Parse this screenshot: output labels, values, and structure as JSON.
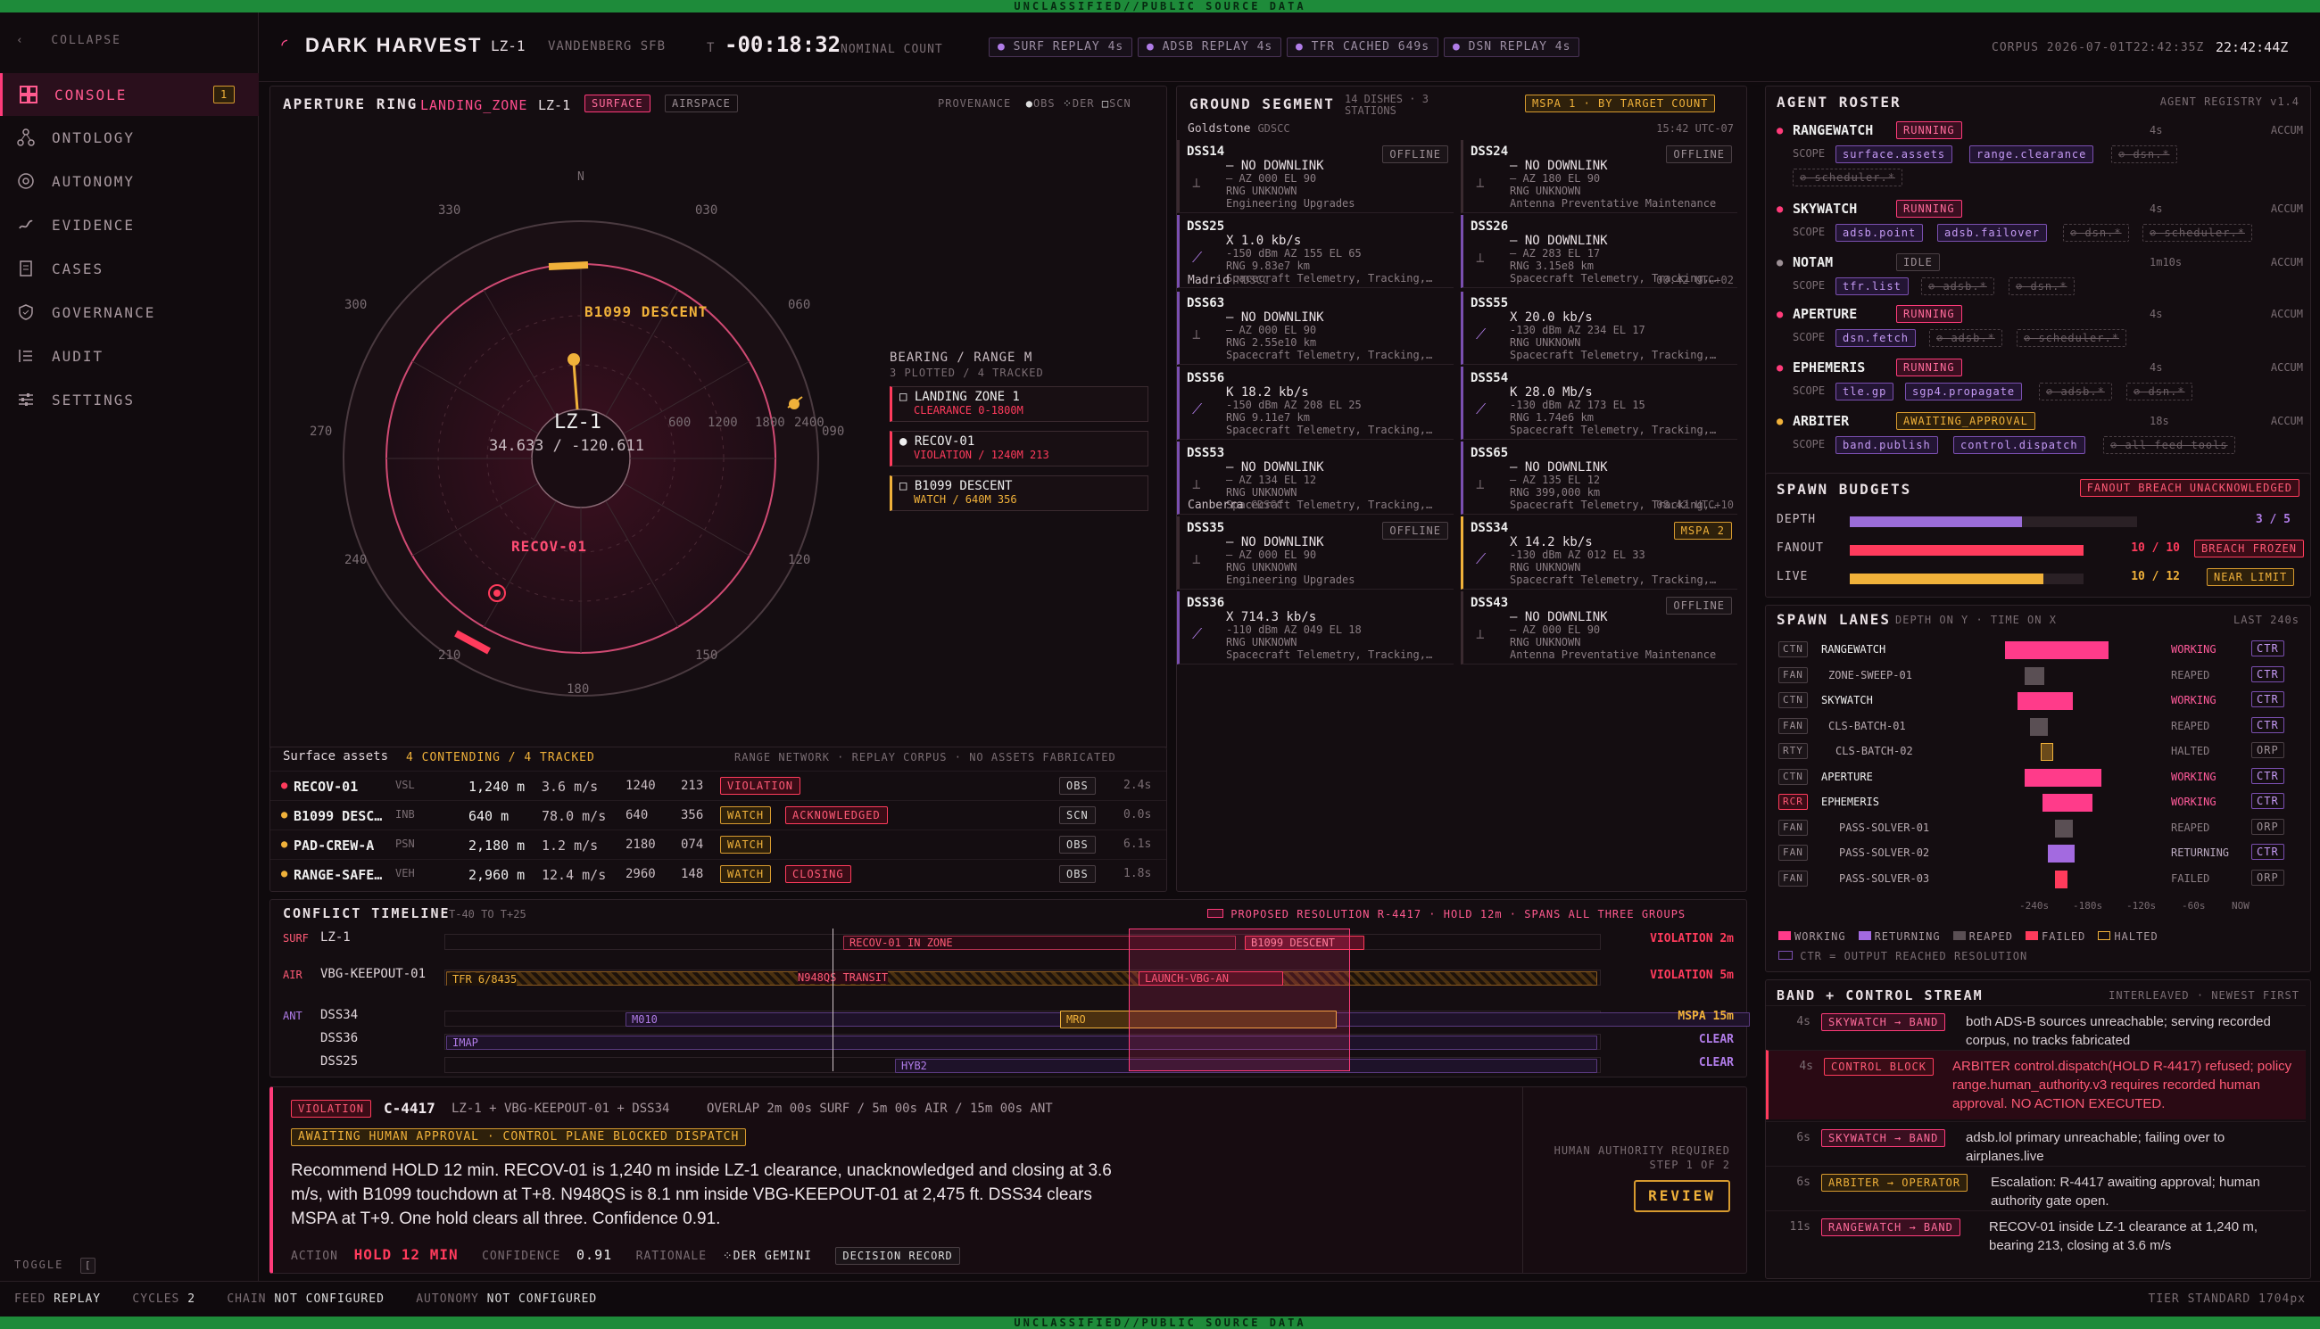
{
  "classification": "UNCLASSIFIED//PUBLIC SOURCE DATA",
  "sidebar": {
    "collapse": "COLLAPSE",
    "items": [
      {
        "label": "CONSOLE",
        "badge": "1"
      },
      {
        "label": "ONTOLOGY"
      },
      {
        "label": "AUTONOMY"
      },
      {
        "label": "EVIDENCE"
      },
      {
        "label": "CASES"
      },
      {
        "label": "GOVERNANCE"
      },
      {
        "label": "AUDIT"
      },
      {
        "label": "SETTINGS"
      }
    ],
    "toggle": "TOGGLE",
    "toggle_key": "["
  },
  "header": {
    "title": "DARK HARVEST",
    "zone": "LZ-1",
    "site": "VANDENBERG SFB",
    "t_label": "T",
    "countdown": "-00:18:32",
    "count_label": "NOMINAL COUNT",
    "chips": [
      "SURF REPLAY 4s",
      "ADSB REPLAY 4s",
      "TFR CACHED 649s",
      "DSN REPLAY 4s"
    ],
    "corpus": "CORPUS 2026-07-01T22:42:35Z",
    "clock": "22:42:44Z"
  },
  "aperture": {
    "title": "APERTURE RING",
    "zone_kind": "LANDING_ZONE",
    "zone": "LZ-1",
    "tab_surface": "SURFACE",
    "tab_airspace": "AIRSPACE",
    "prov_label": "PROVENANCE",
    "prov": [
      "OBS",
      "DER",
      "SCN"
    ],
    "center_label": "LZ-1",
    "center_coords": "34.633 / -120.611",
    "bearings": [
      "N",
      "030",
      "060",
      "090",
      "120",
      "150",
      "180",
      "210",
      "240",
      "270",
      "300",
      "330"
    ],
    "ranges": [
      "600",
      "1200",
      "1800",
      "2400"
    ],
    "target1": "B1099 DESCENT",
    "target2": "RECOV-01",
    "bearing_title": "BEARING / RANGE M",
    "bearing_sub": "3 PLOTTED / 4 TRACKED",
    "bearing_items": [
      {
        "name": "LANDING ZONE 1",
        "sub": "CLEARANCE 0-1800M"
      },
      {
        "name": "RECOV-01",
        "sub": "VIOLATION / 1240M 213"
      },
      {
        "name": "B1099 DESCENT",
        "sub": "WATCH / 640M 356"
      }
    ]
  },
  "assets": {
    "title": "Surface assets",
    "contending": "4 CONTENDING / 4 TRACKED",
    "note": "RANGE NETWORK · REPLAY CORPUS · NO ASSETS FABRICATED",
    "rows": [
      {
        "name": "RECOV-01",
        "type": "VSL",
        "range": "1,240 m",
        "speed": "3.6 m/s",
        "r": "1240",
        "b": "213",
        "tags": [
          "VIOLATION"
        ],
        "prov": "OBS",
        "age": "2.4s",
        "dot": "#ff3b5c"
      },
      {
        "name": "B1099 DESC…",
        "type": "INB",
        "range": "640 m",
        "speed": "78.0 m/s",
        "r": "640",
        "b": "356",
        "tags": [
          "WATCH",
          "ACKNOWLEDGED"
        ],
        "prov": "SCN",
        "age": "0.0s",
        "dot": "#f0b13a"
      },
      {
        "name": "PAD-CREW-A",
        "type": "PSN",
        "range": "2,180 m",
        "speed": "1.2 m/s",
        "r": "2180",
        "b": "074",
        "tags": [
          "WATCH"
        ],
        "prov": "OBS",
        "age": "6.1s",
        "dot": "#f0b13a"
      },
      {
        "name": "RANGE-SAFE…",
        "type": "VEH",
        "range": "2,960 m",
        "speed": "12.4 m/s",
        "r": "2960",
        "b": "148",
        "tags": [
          "WATCH",
          "CLOSING"
        ],
        "prov": "OBS",
        "age": "1.8s",
        "dot": "#f0b13a"
      }
    ]
  },
  "ground": {
    "title": "GROUND SEGMENT",
    "sub": "14 DISHES · 3 STATIONS",
    "mspa": "MSPA 1 · BY TARGET COUNT",
    "stations": [
      {
        "name": "Goldstone",
        "code": "GDSCC",
        "time": "15:42 UTC-07"
      },
      {
        "name": "Madrid",
        "code": "MDSCC",
        "time": "00:42 UTC+02"
      },
      {
        "name": "Canberra",
        "code": "CDSCC",
        "time": "08:42 UTC+10"
      }
    ],
    "dishes": [
      {
        "id": "DSS14",
        "badge": "OFFLINE",
        "l1": "— NO DOWNLINK",
        "l2": "— AZ 000 EL 90",
        "l3": "RNG UNKNOWN",
        "l4": "Engineering Upgrades"
      },
      {
        "id": "DSS24",
        "badge": "OFFLINE",
        "l1": "— NO DOWNLINK",
        "l2": "— AZ 180 EL 90",
        "l3": "RNG UNKNOWN",
        "l4": "Antenna Preventative Maintenance"
      },
      {
        "id": "DSS25",
        "badge": "",
        "l1": "X 1.0 kb/s",
        "l2": "-150 dBm AZ 155 EL 65",
        "l3": "RNG 9.83e7 km",
        "l4": "Spacecraft Telemetry, Tracking,…"
      },
      {
        "id": "DSS26",
        "badge": "",
        "l1": "— NO DOWNLINK",
        "l2": "— AZ 283 EL 17",
        "l3": "RNG 3.15e8 km",
        "l4": "Spacecraft Telemetry, Tracking,…"
      },
      {
        "id": "DSS63",
        "badge": "",
        "l1": "— NO DOWNLINK",
        "l2": "— AZ 000 EL 90",
        "l3": "RNG 2.55e10 km",
        "l4": "Spacecraft Telemetry, Tracking,…"
      },
      {
        "id": "DSS55",
        "badge": "",
        "l1": "X 20.0 kb/s",
        "l2": "-130 dBm AZ 234 EL 17",
        "l3": "RNG UNKNOWN",
        "l4": "Spacecraft Telemetry, Tracking,…"
      },
      {
        "id": "DSS56",
        "badge": "",
        "l1": "K 18.2 kb/s",
        "l2": "-150 dBm AZ 208 EL 25",
        "l3": "RNG 9.11e7 km",
        "l4": "Spacecraft Telemetry, Tracking,…"
      },
      {
        "id": "DSS54",
        "badge": "",
        "l1": "K 28.0 Mb/s",
        "l2": "-130 dBm AZ 173 EL 15",
        "l3": "RNG 1.74e6 km",
        "l4": "Spacecraft Telemetry, Tracking,…"
      },
      {
        "id": "DSS53",
        "badge": "",
        "l1": "— NO DOWNLINK",
        "l2": "— AZ 134 EL 12",
        "l3": "RNG UNKNOWN",
        "l4": "Spacecraft Telemetry, Tracking,…"
      },
      {
        "id": "DSS65",
        "badge": "",
        "l1": "— NO DOWNLINK",
        "l2": "— AZ 135 EL 12",
        "l3": "RNG 399,000 km",
        "l4": "Spacecraft Telemetry, Tracking,…"
      },
      {
        "id": "DSS35",
        "badge": "OFFLINE",
        "l1": "— NO DOWNLINK",
        "l2": "— AZ 000 EL 90",
        "l3": "RNG UNKNOWN",
        "l4": "Engineering Upgrades"
      },
      {
        "id": "DSS34",
        "badge": "MSPA 2",
        "l1": "X 14.2 kb/s",
        "l2": "-130 dBm AZ 012 EL 33",
        "l3": "RNG UNKNOWN",
        "l4": "Spacecraft Telemetry, Tracking,…"
      },
      {
        "id": "DSS36",
        "badge": "",
        "l1": "X 714.3 kb/s",
        "l2": "-110 dBm AZ 049 EL 18",
        "l3": "RNG UNKNOWN",
        "l4": "Spacecraft Telemetry, Tracking,…"
      },
      {
        "id": "DSS43",
        "badge": "OFFLINE",
        "l1": "— NO DOWNLINK",
        "l2": "— AZ 000 EL 90",
        "l3": "RNG UNKNOWN",
        "l4": "Antenna Preventative Maintenance"
      }
    ]
  },
  "timeline": {
    "title": "CONFLICT TIMELINE",
    "range": "T-40 TO T+25",
    "proposed": "PROPOSED RESOLUTION R-4417 · HOLD 12m · SPANS ALL THREE GROUPS",
    "surf": "SURF",
    "air": "AIR",
    "ant": "ANT",
    "lz": "LZ-1",
    "keepout": "VBG-KEEPOUT-01",
    "dss34": "DSS34",
    "dss36": "DSS36",
    "dss25": "DSS25",
    "bars": {
      "recov": "RECOV-01 IN ZONE",
      "b1099": "B1099 DESCENT",
      "tfr": "TFR 6/8435",
      "n948": "N948QS TRANSIT",
      "launch": "LAUNCH-VBG-AN",
      "m010": "M010",
      "mro": "MRO",
      "imap": "IMAP",
      "hyb2": "HYB2"
    },
    "right": [
      "VIOLATION 2m",
      "VIOLATION 5m",
      "MSPA 15m",
      "CLEAR",
      "CLEAR"
    ]
  },
  "decision": {
    "violation": "VIOLATION",
    "id": "C-4417",
    "scope": "LZ-1 + VBG-KEEPOUT-01 + DSS34",
    "overlap": "OVERLAP 2m 00s SURF / 5m 00s AIR / 15m 00s ANT",
    "awaiting": "AWAITING HUMAN APPROVAL · CONTROL PLANE BLOCKED DISPATCH",
    "body": "Recommend HOLD 12 min. RECOV-01 is 1,240 m inside LZ-1 clearance, unacknowledged and closing at 3.6 m/s, with B1099 touchdown at T+8. N948QS is 8.1 nm inside VBG-KEEPOUT-01 at 2,475 ft. DSS34 clears MSPA at T+9. One hold clears all three. Confidence 0.91.",
    "action_label": "ACTION",
    "action": "HOLD 12 MIN",
    "conf_label": "CONFIDENCE",
    "conf": "0.91",
    "rat_label": "RATIONALE",
    "rat": "DER GEMINI",
    "record": "DECISION RECORD",
    "human": "HUMAN AUTHORITY REQUIRED",
    "step": "STEP 1 OF 2",
    "review": "REVIEW"
  },
  "roster": {
    "title": "AGENT ROSTER",
    "registry": "AGENT REGISTRY v1.4",
    "agents": [
      {
        "name": "RANGEWATCH",
        "state": "RUNNING",
        "age": "4s",
        "accum": "ACCUM",
        "scope": [
          "surface.assets",
          "range.clearance"
        ],
        "denied": [
          "dsn.*",
          "scheduler.*"
        ]
      },
      {
        "name": "SKYWATCH",
        "state": "RUNNING",
        "age": "4s",
        "accum": "ACCUM",
        "scope": [
          "adsb.point",
          "adsb.failover"
        ],
        "denied": [
          "dsn.*",
          "scheduler.*"
        ]
      },
      {
        "name": "NOTAM",
        "state": "IDLE",
        "age": "1m10s",
        "accum": "ACCUM",
        "scope": [
          "tfr.list"
        ],
        "denied": [
          "adsb.*",
          "dsn.*"
        ]
      },
      {
        "name": "APERTURE",
        "state": "RUNNING",
        "age": "4s",
        "accum": "ACCUM",
        "scope": [
          "dsn.fetch"
        ],
        "denied": [
          "adsb.*",
          "scheduler.*"
        ]
      },
      {
        "name": "EPHEMERIS",
        "state": "RUNNING",
        "age": "4s",
        "accum": "ACCUM",
        "scope": [
          "tle.gp",
          "sgp4.propagate"
        ],
        "denied": [
          "adsb.*",
          "dsn.*"
        ]
      },
      {
        "name": "ARBITER",
        "state": "AWAITING_APPROVAL",
        "age": "18s",
        "accum": "ACCUM",
        "scope": [
          "band.publish",
          "control.dispatch"
        ],
        "denied": [
          "all feed tools"
        ]
      }
    ]
  },
  "budgets": {
    "title": "SPAWN BUDGETS",
    "alert": "FANOUT BREACH UNACKNOWLEDGED",
    "rows": [
      {
        "label": "DEPTH",
        "value": "3 / 5",
        "fill": 0.6,
        "tag": ""
      },
      {
        "label": "FANOUT",
        "value": "10 / 10",
        "fill": 1.0,
        "tag": "BREACH FROZEN"
      },
      {
        "label": "LIVE",
        "value": "10 / 12",
        "fill": 0.83,
        "tag": "NEAR LIMIT"
      }
    ]
  },
  "lanes": {
    "title": "SPAWN LANES",
    "sub": "DEPTH ON Y · TIME ON X",
    "window": "LAST 240s",
    "rows": [
      {
        "kind": "CTN",
        "name": "RANGEWATCH",
        "state": "WORKING",
        "act": "CTR"
      },
      {
        "kind": "FAN",
        "name": "ZONE-SWEEP-01",
        "state": "REAPED",
        "act": "CTR"
      },
      {
        "kind": "CTN",
        "name": "SKYWATCH",
        "state": "WORKING",
        "act": "CTR"
      },
      {
        "kind": "FAN",
        "name": "CLS-BATCH-01",
        "state": "REAPED",
        "act": "CTR"
      },
      {
        "kind": "RTY",
        "name": "CLS-BATCH-02",
        "state": "HALTED",
        "act": "ORP"
      },
      {
        "kind": "CTN",
        "name": "APERTURE",
        "state": "WORKING",
        "act": "CTR"
      },
      {
        "kind": "RCR",
        "name": "EPHEMERIS",
        "state": "WORKING",
        "act": "CTR"
      },
      {
        "kind": "FAN",
        "name": "PASS-SOLVER-01",
        "state": "REAPED",
        "act": "ORP"
      },
      {
        "kind": "FAN",
        "name": "PASS-SOLVER-02",
        "state": "RETURNING",
        "act": "CTR"
      },
      {
        "kind": "FAN",
        "name": "PASS-SOLVER-03",
        "state": "FAILED",
        "act": "ORP"
      }
    ],
    "axis": [
      "-240s",
      "-180s",
      "-120s",
      "-60s",
      "NOW"
    ],
    "legend": [
      "WORKING",
      "RETURNING",
      "REAPED",
      "FAILED",
      "HALTED"
    ],
    "ctr_note": "CTR = OUTPUT REACHED RESOLUTION"
  },
  "stream": {
    "title": "BAND + CONTROL STREAM",
    "sub": "INTERLEAVED · NEWEST FIRST",
    "items": [
      {
        "age": "4s",
        "src": "SKYWATCH → BAND",
        "text": "both ADS-B sources unreachable; serving recorded corpus, no tracks fabricated"
      },
      {
        "age": "4s",
        "src": "CONTROL BLOCK",
        "text": "ARBITER control.dispatch(HOLD R-4417) refused; policy range.human_authority.v3 requires recorded human approval. NO ACTION EXECUTED."
      },
      {
        "age": "6s",
        "src": "SKYWATCH → BAND",
        "text": "adsb.lol primary unreachable; failing over to airplanes.live"
      },
      {
        "age": "6s",
        "src": "ARBITER → OPERATOR",
        "text": "Escalation: R-4417 awaiting approval; human authority gate open."
      },
      {
        "age": "11s",
        "src": "RANGEWATCH → BAND",
        "text": "RECOV-01 inside LZ-1 clearance at 1,240 m, bearing 213, closing at 3.6 m/s"
      }
    ]
  },
  "status": {
    "feed_label": "FEED",
    "feed": "REPLAY",
    "cycles_label": "CYCLES",
    "cycles": "2",
    "chain_label": "CHAIN",
    "chain": "NOT CONFIGURED",
    "auto_label": "AUTONOMY",
    "auto": "NOT CONFIGURED",
    "tier": "TIER STANDARD 1704px"
  }
}
